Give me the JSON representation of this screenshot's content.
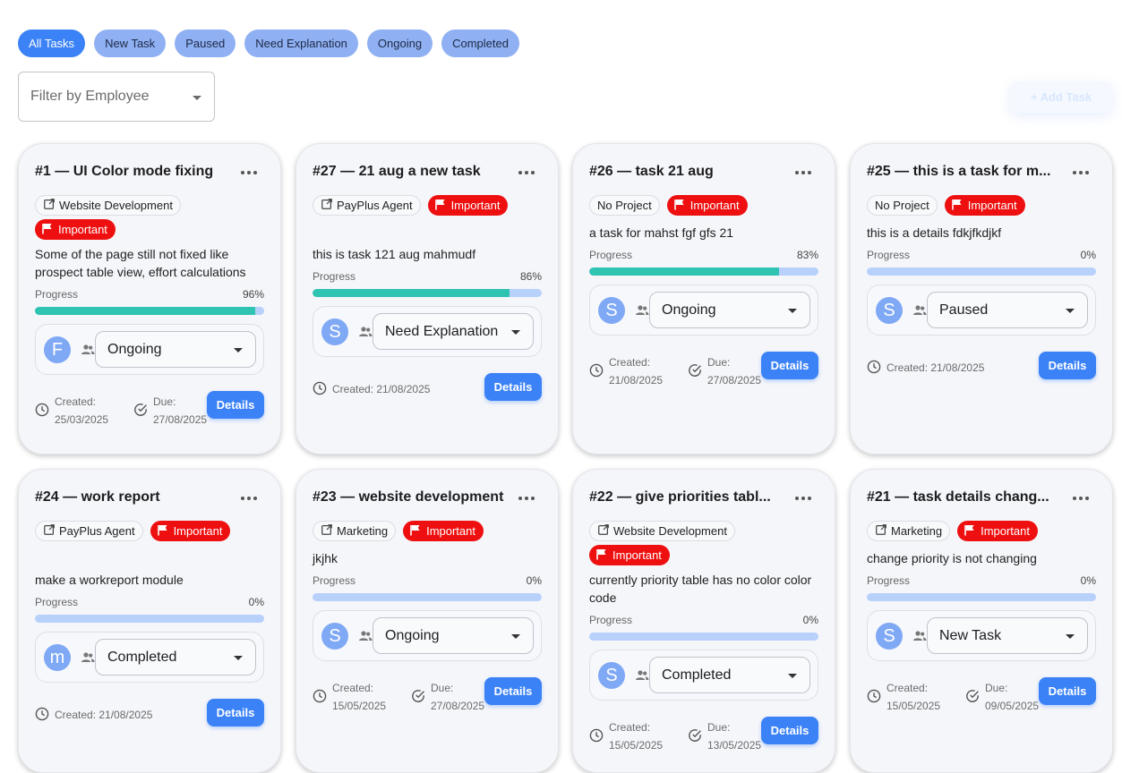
{
  "filters": [
    "All Tasks",
    "New Task",
    "Paused",
    "Need Explanation",
    "Ongoing",
    "Completed"
  ],
  "employee_filter_placeholder": "Filter by Employee",
  "add_task_label": "+ Add Task",
  "progress_label": "Progress",
  "created_label": "Created:",
  "due_label": "Due:",
  "details_label": "Details",
  "important_label": "Important",
  "colors": {
    "accent": "#3b82f6",
    "chip": "#8fb0f3",
    "important": "#ee1010",
    "progress_fill": "#2fc3b2",
    "progress_track": "#b8d1fb"
  },
  "cards": [
    {
      "title": "#1 — UI Color mode fixing",
      "project": "Website Development",
      "project_icon": "external-link-icon",
      "important": true,
      "description": "Some of the page still not fixed like prospect table view, effort calculations",
      "progress": 96,
      "progress_text": "96%",
      "avatar": "F",
      "status": "Ongoing",
      "created": "25/03/2025",
      "due": "27/08/2025"
    },
    {
      "title": "#27 — 21 aug a new task",
      "project": "PayPlus Agent",
      "project_icon": "external-link-icon",
      "important": true,
      "description": "this is task 121 aug mahmudf",
      "progress": 86,
      "progress_text": "86%",
      "avatar": "S",
      "status": "Need Explanation",
      "created": "21/08/2025",
      "due": ""
    },
    {
      "title": "#26 — task 21 aug",
      "project": "No Project",
      "project_icon": "",
      "important": true,
      "description": "a task for mahst fgf gfs 21",
      "progress": 83,
      "progress_text": "83%",
      "avatar": "S",
      "status": "Ongoing",
      "created": "21/08/2025",
      "due": "27/08/2025"
    },
    {
      "title": "#25 — this is a task for m...",
      "project": "No Project",
      "project_icon": "",
      "important": true,
      "description": "this is a details fdkjfkdjkf",
      "progress": 0,
      "progress_text": "0%",
      "avatar": "S",
      "status": "Paused",
      "created": "21/08/2025",
      "due": ""
    },
    {
      "title": "#24 — work report",
      "project": "PayPlus Agent",
      "project_icon": "external-link-icon",
      "important": true,
      "description": "make a workreport module",
      "progress": 0,
      "progress_text": "0%",
      "avatar": "m",
      "status": "Completed",
      "created": "21/08/2025",
      "due": ""
    },
    {
      "title": "#23 — website development",
      "project": "Marketing",
      "project_icon": "external-link-icon",
      "important": true,
      "description": "jkjhk",
      "progress": 0,
      "progress_text": "0%",
      "avatar": "S",
      "status": "Ongoing",
      "created": "15/05/2025",
      "due": "27/08/2025"
    },
    {
      "title": "#22 — give priorities tabl...",
      "project": "Website Development",
      "project_icon": "external-link-icon",
      "important": true,
      "description": "currently priority table has no color color code",
      "progress": 0,
      "progress_text": "0%",
      "avatar": "S",
      "status": "Completed",
      "created": "15/05/2025",
      "due": "13/05/2025"
    },
    {
      "title": "#21 — task details chang...",
      "project": "Marketing",
      "project_icon": "external-link-icon",
      "important": true,
      "description": "change priority is not changing",
      "progress": 0,
      "progress_text": "0%",
      "avatar": "S",
      "status": "New Task",
      "created": "15/05/2025",
      "due": "09/05/2025"
    }
  ]
}
